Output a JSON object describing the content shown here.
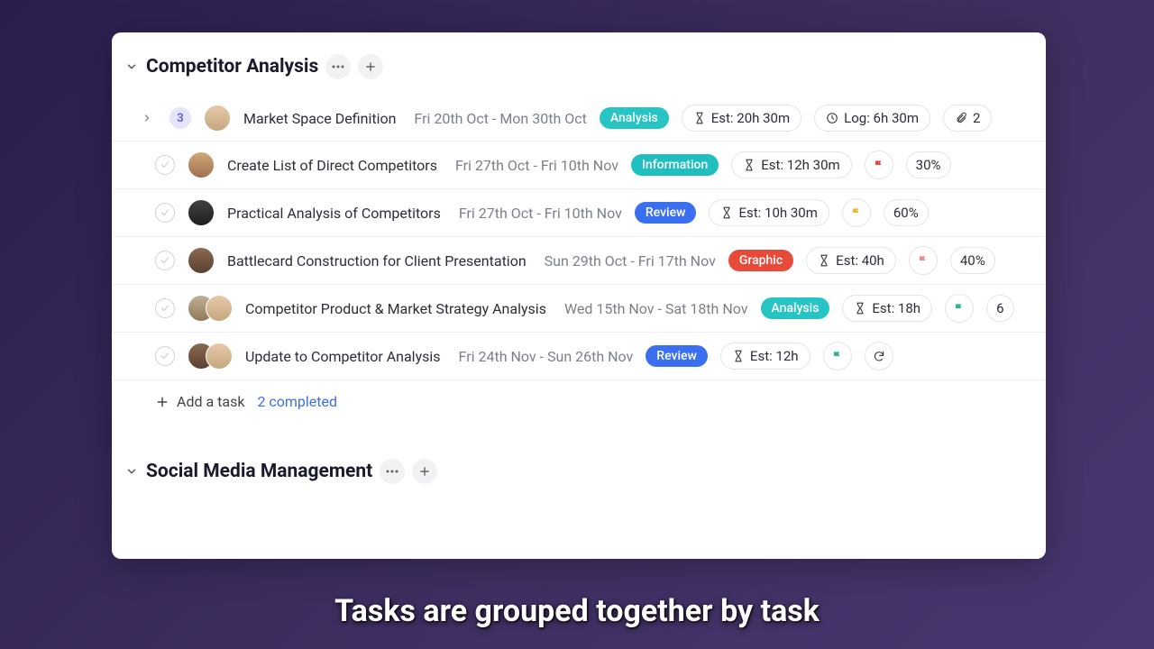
{
  "caption": "Tasks are grouped together by task",
  "groups": [
    {
      "title": "Competitor Analysis",
      "add_task_label": "Add a task",
      "completed_label": "2 completed",
      "tasks": [
        {
          "subtasks": "3",
          "title": "Market Space Definition",
          "dates": "Fri 20th Oct - Mon 30th Oct",
          "tag": "Analysis",
          "est": "Est: 20h 30m",
          "log": "Log: 6h 30m",
          "attach": "2"
        },
        {
          "title": "Create List of Direct Competitors",
          "dates": "Fri 27th Oct - Fri 10th Nov",
          "tag": "Information",
          "est": "Est: 12h 30m",
          "percent": "30%"
        },
        {
          "title": "Practical Analysis of Competitors",
          "dates": "Fri 27th Oct - Fri 10th Nov",
          "tag": "Review",
          "est": "Est: 10h 30m",
          "percent": "60%"
        },
        {
          "title": "Battlecard Construction for Client Presentation",
          "dates": "Sun 29th Oct - Fri 17th Nov",
          "tag": "Graphic",
          "est": "Est: 40h",
          "percent": "40%"
        },
        {
          "title": "Competitor Product & Market Strategy Analysis",
          "dates": "Wed 15th Nov - Sat 18th Nov",
          "tag": "Analysis",
          "est": "Est: 18h",
          "percent": "6"
        },
        {
          "title": "Update to Competitor Analysis",
          "dates": "Fri 24th Nov - Sun 26th Nov",
          "tag": "Review",
          "est": "Est: 12h"
        }
      ]
    },
    {
      "title": "Social Media Management"
    }
  ]
}
